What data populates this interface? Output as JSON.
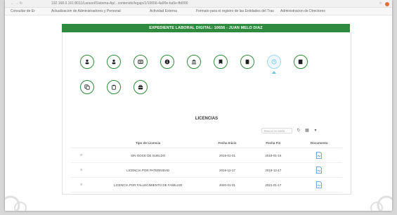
{
  "browser": {
    "url": "192.168.0.161:8011/Laravel/Sistema-Ap/...contenido/legajo/1/10656-4a90e-ba5e-ffd000",
    "bookmarks": [
      "Consultar de Er",
      "Actualizacion de Administradores y Personal",
      "Actividad Externa",
      "Formato para el registro de las Entidades del Tras",
      "Administracion de Directores"
    ]
  },
  "header": {
    "title": "EXPEDIENTE LABORAL DIGITAL: 10656 - JUAN MELO DIAZ"
  },
  "icons_row1": [
    "user-icon",
    "user-icon",
    "id-card-icon",
    "info-icon",
    "institution-icon",
    "bookmark-icon",
    "file-icon",
    "clock-icon",
    "book-icon"
  ],
  "icons_row2": [
    "copy-icon",
    "clipboard-icon",
    "briefcase-icon"
  ],
  "section": {
    "title": "LICENCIAS"
  },
  "search": {
    "placeholder": "Buscar en tabla"
  },
  "table": {
    "columns": [
      "Tipo de Licencia",
      "Fecha Inicio",
      "Fecha Fin",
      "Documento"
    ],
    "rows": [
      {
        "tipo": "SIN GOCE DE SUELDO",
        "inicio": "2019-01-01",
        "fin": "2019-01-16"
      },
      {
        "tipo": "LICENCIA POR PATERNIDAD",
        "inicio": "2019-12-17",
        "fin": "2019-12-17"
      },
      {
        "tipo": "LICENCIA POR FALLECIMIENTO DE FAMILIAR",
        "inicio": "2020-01-01",
        "fin": "2021-01-17"
      }
    ]
  },
  "colors": {
    "accent": "#2e8b3e",
    "active": "#6cc3e3",
    "pdf": "#4a8fd6"
  }
}
